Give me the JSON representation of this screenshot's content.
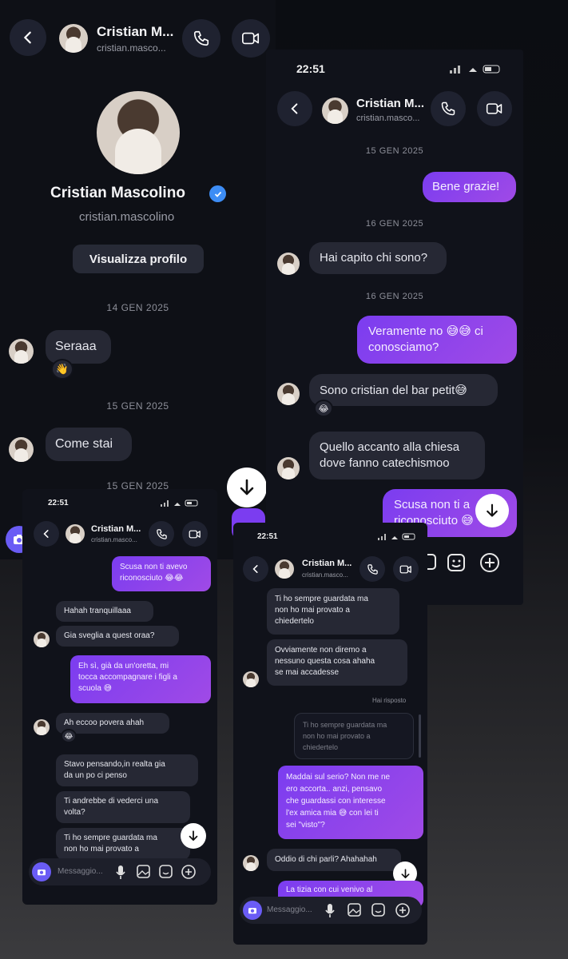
{
  "panel1": {
    "contact_name": "Cristian M...",
    "contact_user": "cristian.masco...",
    "profile_name": "Cristian Mascolino",
    "profile_user": "cristian.mascolino",
    "view_profile": "Visualizza profilo",
    "date1": "14 GEN 2025",
    "msg1": "Seraaa",
    "date2": "15 GEN 2025",
    "msg2": "Come stai",
    "date3": "15 GEN 2025"
  },
  "panel2": {
    "time": "22:51",
    "contact_name": "Cristian M...",
    "contact_user": "cristian.masco...",
    "date1": "15 GEN 2025",
    "out1": "Bene grazie!",
    "date2": "16 GEN 2025",
    "in1": "Hai capito chi sono?",
    "date3": "16 GEN 2025",
    "out2_l1": "Veramente no 😅😅 ci",
    "out2_l2": "conosciamo?",
    "in2": "Sono cristian del bar petit😅",
    "in3_l1": "Quello accanto alla chiesa",
    "in3_l2": "dove fanno catechismoo",
    "out3_l1": "Scusa non ti a",
    "out3_l2": "riconosciuto 😅"
  },
  "panel3": {
    "time": "22:51",
    "contact_name": "Cristian M...",
    "contact_user": "cristian.masco...",
    "out1_l1": "Scusa non ti avevo",
    "out1_l2": "riconosciuto 😂😂",
    "in1": "Hahah tranquillaaa",
    "in2": "Gia sveglia a quest oraa?",
    "out2_l1": "Eh sì, già da un'oretta, mi",
    "out2_l2": "tocca accompagnare i figli a",
    "out2_l3": "scuola 😅",
    "in3": "Ah eccoo povera ahah",
    "in4_l1": "Stavo pensando,in realta gia",
    "in4_l2": "da un po ci penso",
    "in5_l1": "Ti andrebbe di vederci una",
    "in5_l2": "volta?",
    "in6_l1": "Ti ho sempre guardata ma",
    "in6_l2": "non ho mai provato a",
    "placeholder": "Messaggio..."
  },
  "panel4": {
    "time": "22:51",
    "contact_name": "Cristian M...",
    "contact_user": "cristian.masco...",
    "in1_l1": "Ti ho sempre guardata ma",
    "in1_l2": "non ho mai provato a",
    "in1_l3": "chiedertelo",
    "in2_l1": "Ovviamente non diremo a",
    "in2_l2": "nessuno questa cosa ahaha",
    "in2_l3": "se mai accadesse",
    "replied": "Hai risposto",
    "quote_l1": "Ti ho sempre guardata ma",
    "quote_l2": "non ho mai provato a",
    "quote_l3": "chiedertelo",
    "out1_l1": "Maddai sul serio? Non me ne",
    "out1_l2": "ero accorta.. anzi, pensavo",
    "out1_l3": "che guardassi con interesse",
    "out1_l4": "l'ex amica mia 😅 con lei ti",
    "out1_l5": "sei \"visto\"?",
    "in3": "Oddio di chi parli? Ahahahah",
    "out2": "La tizia con cui venivo al",
    "placeholder": "Messaggio..."
  }
}
